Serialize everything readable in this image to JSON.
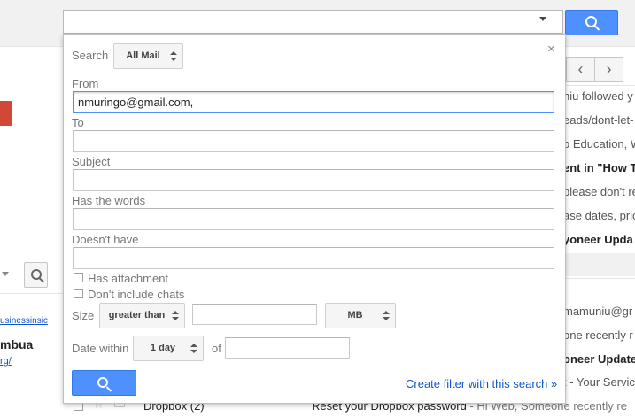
{
  "search_bar": {
    "value": "",
    "dropdown_icon": "caret-down-icon",
    "button_icon": "search-icon"
  },
  "panel": {
    "search_label": "Search",
    "search_scope": "All Mail",
    "from_label": "From",
    "from_value": "nmuringo@gmail.com,",
    "to_label": "To",
    "to_value": "",
    "subject_label": "Subject",
    "subject_value": "",
    "has_words_label": "Has the words",
    "has_words_value": "",
    "doesnt_have_label": "Doesn't have",
    "doesnt_have_value": "",
    "has_attachment_label": "Has attachment",
    "dont_include_chats_label": "Don't include chats",
    "size_label": "Size",
    "size_operator": "greater than",
    "size_value": "",
    "size_unit": "MB",
    "date_within_label": "Date within",
    "date_within_value": "1 day",
    "of_label": "of",
    "of_value": "",
    "close_symbol": "×",
    "create_filter_label": "Create filter with this search »"
  },
  "background": {
    "left_fragments": [
      "usinessinsic",
      "mbua",
      "rg/"
    ],
    "nav_prev": "‹",
    "nav_next": "›",
    "rows": [
      "niu followed y",
      "eads/dont-let-",
      "o Education, W",
      "ent in \"How To",
      "please don't re",
      "ase dates, pric",
      "yoneer Upda",
      "",
      "mamuniu@gr",
      "one recently r",
      "oneer Update",
      "t - Your Servic"
    ],
    "bottom_row": {
      "sender": "Dropbox (2)",
      "subject": "Reset your Dropbox password",
      "snippet": " - Hi Web, Someone recently re"
    }
  },
  "colors": {
    "accent": "#4d90fe",
    "link": "#1155cc",
    "compose": "#d14836"
  }
}
